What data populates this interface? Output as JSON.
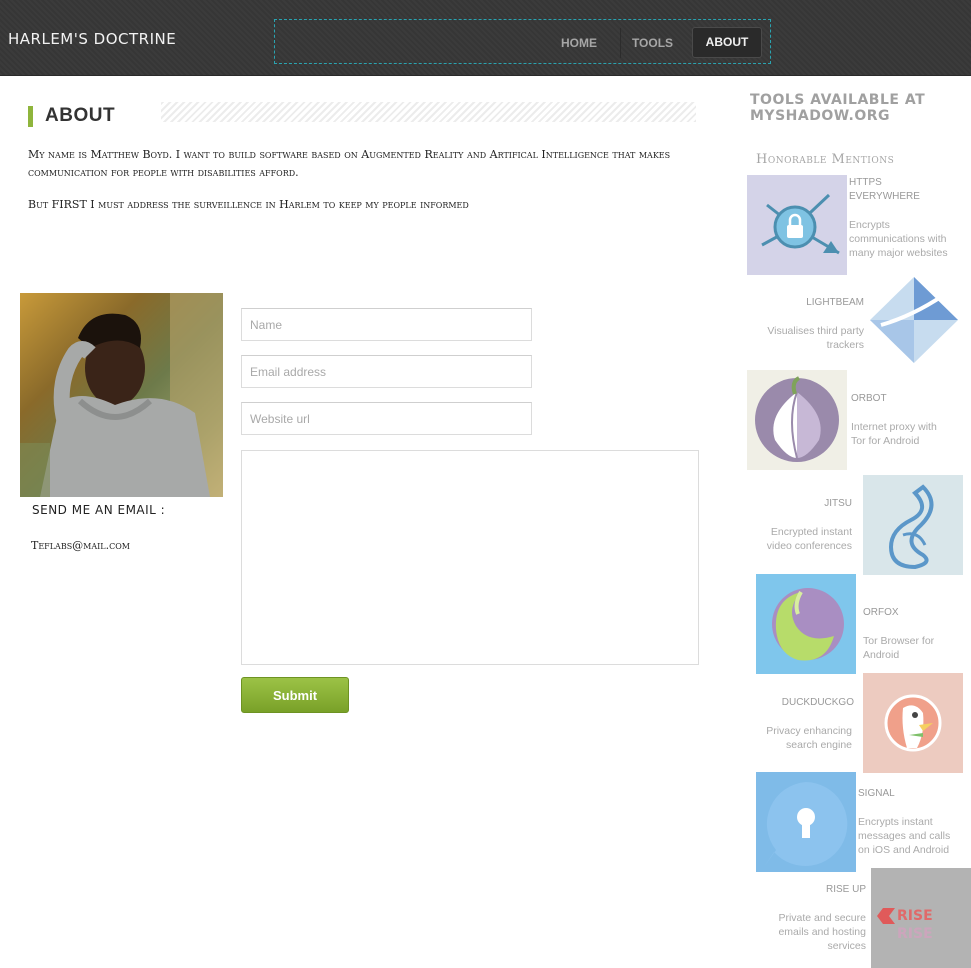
{
  "header": {
    "site_title": "HARLEM'S DOCTRINE",
    "nav": [
      {
        "label": "HOME"
      },
      {
        "label": "TOOLS"
      },
      {
        "label": "ABOUT",
        "active": true
      }
    ]
  },
  "about": {
    "title": "ABOUT",
    "paragraphs": [
      "My name is Matthew Boyd. I want to build software based on Augmented Reality and Artifical Intelligence that makes communication for people with disabilities afford.",
      "But FIRST I must address the surveillence in Harlem to keep my people informed"
    ],
    "send_label": "SEND ME AN EMAIL :",
    "email": "Teflabs@mail.com"
  },
  "form": {
    "name_placeholder": "Name",
    "email_placeholder": "Email address",
    "website_placeholder": "Website url",
    "submit_label": "Submit"
  },
  "sidebar": {
    "heading": "TOOLS AVAILABLE AT MYSHADOW.ORG",
    "subheading": "Honorable Mentions",
    "tools": [
      {
        "name": "HTTPS EVERYWHERE",
        "desc": "Encrypts communications with many major websites",
        "icon": "https-everywhere-icon"
      },
      {
        "name": "LIGHTBEAM",
        "desc": "Visualises third party trackers",
        "icon": "lightbeam-icon"
      },
      {
        "name": "ORBOT",
        "desc": "Internet proxy with Tor for Android",
        "icon": "orbot-icon"
      },
      {
        "name": "JITSU",
        "desc": "Encrypted instant video conferences",
        "icon": "jitsi-icon"
      },
      {
        "name": "ORFOX",
        "desc": "Tor Browser for Android",
        "icon": "orfox-icon"
      },
      {
        "name": "DUCKDUCKGO",
        "desc": "Privacy enhancing search engine",
        "icon": "duckduckgo-icon"
      },
      {
        "name": "SIGNAL",
        "desc": "Encrypts instant messages and calls on iOS and Android",
        "icon": "signal-icon"
      },
      {
        "name": "RISE UP",
        "desc": "Private and secure emails and hosting services",
        "icon": "riseup-icon"
      }
    ]
  },
  "colors": {
    "accent": "#8fb53c",
    "header_bg": "#3b3b3b",
    "nav_border": "#2aa3b0"
  }
}
